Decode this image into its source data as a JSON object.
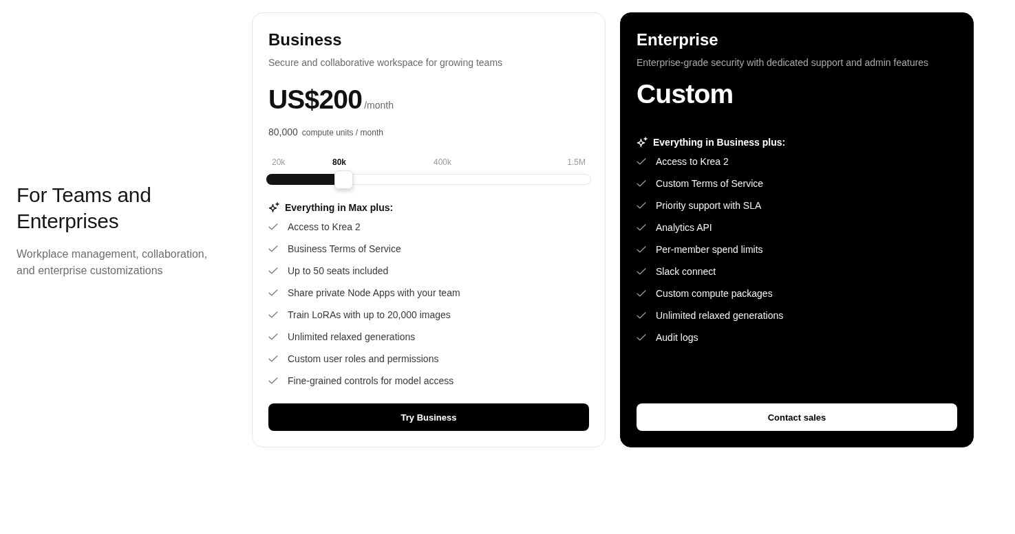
{
  "intro": {
    "title": "For Teams and Enterprises",
    "subtitle": "Workplace management, collaboration, and enterprise customizations"
  },
  "plans": [
    {
      "kind": "light",
      "name": "Business",
      "description": "Secure and collaborative workspace for growing teams",
      "price": {
        "amount": "US$200",
        "period": "/month"
      },
      "credits": {
        "amount": "80,000",
        "unit": "compute units / month"
      },
      "slider": {
        "level": 0.237,
        "stops": [
          {
            "label": "20k",
            "selected": false
          },
          {
            "label": "80k",
            "selected": true
          },
          {
            "label": "400k",
            "selected": false
          },
          {
            "label": "1.5M",
            "selected": false
          }
        ]
      },
      "features_heading": "Everything in Max plus:",
      "features": [
        "Access to Krea 2",
        "Business Terms of Service",
        "Up to 50 seats included",
        "Share private Node Apps with your team",
        "Train LoRAs with up to 20,000 images",
        "Unlimited relaxed generations",
        "Custom user roles and permissions",
        "Fine-grained controls for model access"
      ],
      "button": "Try Business"
    },
    {
      "kind": "dark",
      "name": "Enterprise",
      "description": "Enterprise-grade security with dedicated support and admin features",
      "price": {
        "amount": "Custom"
      },
      "features_heading": "Everything in Business plus:",
      "features": [
        "Access to Krea 2",
        "Custom Terms of Service",
        "Priority support with SLA",
        "Analytics API",
        "Per-member spend limits",
        "Slack connect",
        "Custom compute packages",
        "Unlimited relaxed generations",
        "Audit logs"
      ],
      "button": "Contact sales"
    }
  ]
}
